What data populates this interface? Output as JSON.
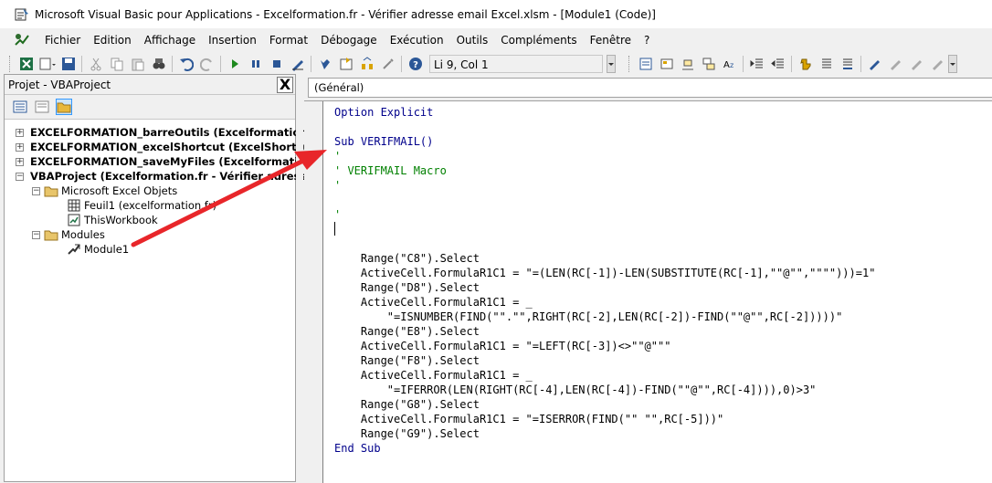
{
  "window": {
    "title": "Microsoft Visual Basic pour Applications - Excelformation.fr - Vérifier adresse email Excel.xlsm - [Module1 (Code)]"
  },
  "menu": [
    "Fichier",
    "Edition",
    "Affichage",
    "Insertion",
    "Format",
    "Débogage",
    "Exécution",
    "Outils",
    "Compléments",
    "Fenêtre",
    "?"
  ],
  "toolbar": {
    "position": "Li 9, Col 1"
  },
  "project": {
    "title": "Projet - VBAProject",
    "close": "X",
    "tree": [
      "EXCELFORMATION_barreOutils (Excelformation.f",
      "EXCELFORMATION_excelShortcut (ExcelShortcut",
      "EXCELFORMATION_saveMyFiles (Excelformation.f",
      "VBAProject (Excelformation.fr - Vérifier adresse",
      "Microsoft Excel Objets",
      "Feuil1 (excelformation.fr)",
      "ThisWorkbook",
      "Modules",
      "Module1"
    ]
  },
  "code": {
    "object_combo": "(Général)",
    "lines": {
      "l1": "Option Explicit",
      "l2": "Sub VERIFMAIL()",
      "l3": "'",
      "l4": "' VERIFMAIL Macro",
      "l5": "'",
      "l6": "'",
      "l7": "    Range(\"C8\").Select",
      "l8": "    ActiveCell.FormulaR1C1 = \"=(LEN(RC[-1])-LEN(SUBSTITUTE(RC[-1],\"\"@\"\",\"\"\"\")))=1\"",
      "l9": "    Range(\"D8\").Select",
      "l10": "    ActiveCell.FormulaR1C1 = _",
      "l11": "        \"=ISNUMBER(FIND(\"\".\"\",RIGHT(RC[-2],LEN(RC[-2])-FIND(\"\"@\"\",RC[-2]))))\"",
      "l12": "    Range(\"E8\").Select",
      "l13": "    ActiveCell.FormulaR1C1 = \"=LEFT(RC[-3])<>\"\"@\"\"\"",
      "l14": "    Range(\"F8\").Select",
      "l15": "    ActiveCell.FormulaR1C1 = _",
      "l16": "        \"=IFERROR(LEN(RIGHT(RC[-4],LEN(RC[-4])-FIND(\"\"@\"\",RC[-4]))),0)>3\"",
      "l17": "    Range(\"G8\").Select",
      "l18": "    ActiveCell.FormulaR1C1 = \"=ISERROR(FIND(\"\" \"\",RC[-5]))\"",
      "l19": "    Range(\"G9\").Select",
      "l20": "End Sub"
    }
  },
  "colors": {
    "keyword": "#00008b",
    "comment": "#008000",
    "arrow": "#e8262a"
  }
}
